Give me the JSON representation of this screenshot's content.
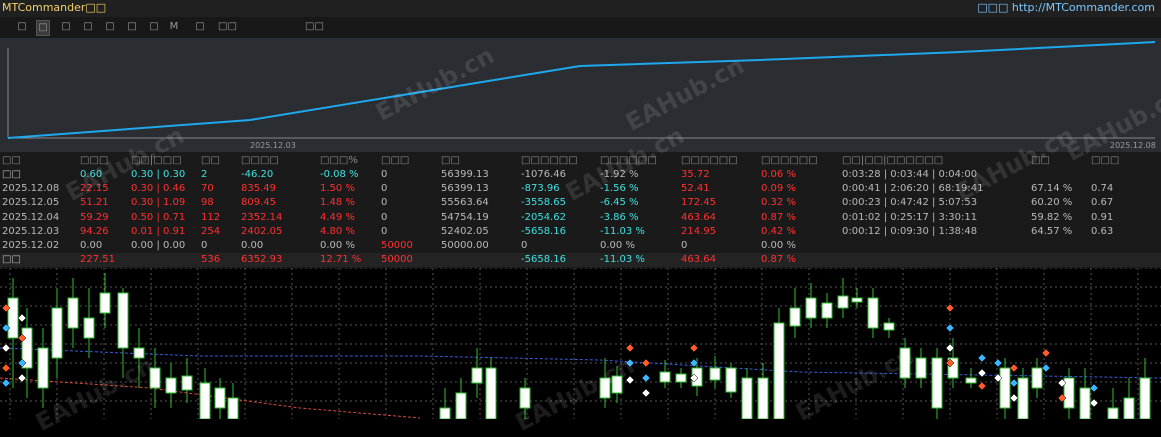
{
  "app": {
    "title": "MTCommander□□",
    "site": "□□□ http://MTCommander.com"
  },
  "toolbar": [
    "□",
    "□",
    "□",
    "□",
    "□",
    "□",
    "□",
    "M",
    "□",
    "□□",
    "□□"
  ],
  "equity_chart": {
    "x_start_label": "2025.12.03",
    "x_end_label": "2025.12.08",
    "line_color": "#1ea8ee",
    "values": [
      0,
      20,
      40,
      60,
      80,
      100
    ]
  },
  "stats": {
    "headers": [
      "□□",
      "□□□",
      "□□|□□□",
      "□□",
      "□□□□",
      "□□□%",
      "□□□",
      "□□",
      "□□□□□□",
      "□□□□□□",
      "□□□□□□",
      "□□□□□□",
      "□□|□□|□□□□□□",
      "□□",
      "□□□"
    ],
    "rows": [
      [
        "□□",
        "0.60",
        "0.30 | 0.30",
        "2",
        "-46.20",
        "-0.08 %",
        "0",
        "56399.13",
        "-1076.46",
        "-1.92 %",
        "35.72",
        "0.06 %",
        "0:03:28 | 0:03:44 | 0:04:00",
        "",
        ""
      ],
      [
        "2025.12.08",
        "22.15",
        "0.30 | 0.46",
        "70",
        "835.49",
        "1.50 %",
        "0",
        "56399.13",
        "-873.96",
        "-1.56 %",
        "52.41",
        "0.09 %",
        "0:00:41 | 2:06:20 | 68:19:41",
        "67.14 %",
        "0.74"
      ],
      [
        "2025.12.05",
        "51.21",
        "0.30 | 1.09",
        "98",
        "809.45",
        "1.48 %",
        "0",
        "55563.64",
        "-3558.65",
        "-6.45 %",
        "172.45",
        "0.32 %",
        "0:00:23 | 0:47:42 | 5:07:53",
        "60.20 %",
        "0.67"
      ],
      [
        "2025.12.04",
        "59.29",
        "0.50 | 0.71",
        "112",
        "2352.14",
        "4.49 %",
        "0",
        "54754.19",
        "-2054.62",
        "-3.86 %",
        "463.64",
        "0.87 %",
        "0:01:02 | 0:25:17 | 3:30:11",
        "59.82 %",
        "0.91"
      ],
      [
        "2025.12.03",
        "94.26",
        "0.01 | 0.91",
        "254",
        "2402.05",
        "4.80 %",
        "0",
        "52402.05",
        "-5658.16",
        "-11.03 %",
        "214.95",
        "0.42 %",
        "0:00:12 | 0:09:30 | 1:38:48",
        "64.57 %",
        "0.63"
      ],
      [
        "2025.12.02",
        "0.00",
        "0.00 | 0.00",
        "0",
        "0.00",
        "0.00 %",
        "50000",
        "50000.00",
        "0",
        "0.00 %",
        "0",
        "0.00 %",
        "",
        "",
        ""
      ]
    ],
    "total": [
      "□□",
      "227.51",
      "",
      "536",
      "6352.93",
      "12.71 %",
      "50000",
      "",
      "-5658.16",
      "-11.03 %",
      "463.64",
      "0.87 %",
      "",
      "",
      ""
    ]
  },
  "watermark": "EAHub.cn"
}
